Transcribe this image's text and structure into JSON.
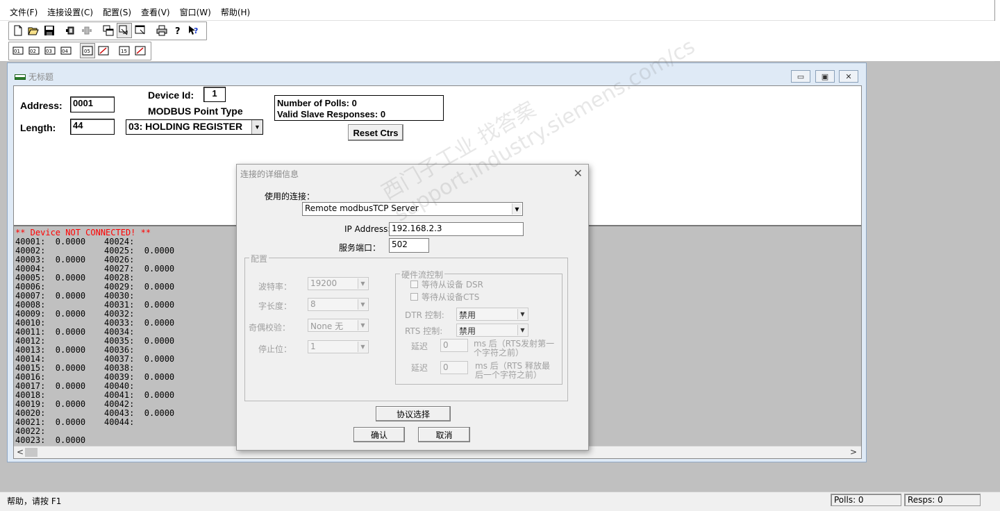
{
  "menu": [
    "文件(F)",
    "连接设置(C)",
    "配置(S)",
    "查看(V)",
    "窗口(W)",
    "帮助(H)"
  ],
  "toolbar1_icons": [
    "new-file-icon",
    "open-folder-icon",
    "save-icon",
    "connect-icon",
    "disconnect-icon",
    "window-tile-icon",
    "window-cascade-icon",
    "window-arrange-icon",
    "print-icon",
    "help-icon",
    "context-help-icon"
  ],
  "toolbar2_icons": [
    "coil-01-icon",
    "input-02-icon",
    "input-03-icon",
    "register-04-icon",
    "function-05-icon",
    "function-06-icon",
    "function-15-icon",
    "function-16-icon"
  ],
  "child_window": {
    "title": "无标题",
    "address_label": "Address:",
    "address_value": "0001",
    "length_label": "Length:",
    "length_value": "44",
    "device_id_label": "Device Id:",
    "device_id_value": "1",
    "point_type_label": "MODBUS Point Type",
    "point_type_value": "03: HOLDING REGISTER",
    "polls_line": "Number of Polls: 0",
    "responses_line": "Valid Slave Responses: 0",
    "reset_button": "Reset Ctrs"
  },
  "data_view": {
    "error": "** Device NOT CONNECTED! **",
    "col1": [
      "40001:  0.0000",
      "40002:",
      "40003:  0.0000",
      "40004:",
      "40005:  0.0000",
      "40006:",
      "40007:  0.0000",
      "40008:",
      "40009:  0.0000",
      "40010:",
      "40011:  0.0000",
      "40012:",
      "40013:  0.0000",
      "40014:",
      "40015:  0.0000",
      "40016:",
      "40017:  0.0000",
      "40018:",
      "40019:  0.0000",
      "40020:",
      "40021:  0.0000",
      "40022:",
      "40023:  0.0000"
    ],
    "col2": [
      "40024:",
      "40025:  0.0000",
      "40026:",
      "40027:  0.0000",
      "40028:",
      "40029:  0.0000",
      "40030:",
      "40031:  0.0000",
      "40032:",
      "40033:  0.0000",
      "40034:",
      "40035:  0.0000",
      "40036:",
      "40037:  0.0000",
      "40038:",
      "40039:  0.0000",
      "40040:",
      "40041:  0.0000",
      "40042:",
      "40043:  0.0000",
      "40044:"
    ]
  },
  "dialog": {
    "title": "连接的详细信息",
    "connection_label": "使用的连接：",
    "connection_value": "Remote modbusTCP Server",
    "ip_label": "IP Address:",
    "ip_value": "192.168.2.3",
    "port_label": "服务端口：",
    "port_value": "502",
    "config_group": "配置",
    "baud_label": "波特率：",
    "baud_value": "19200",
    "wordlen_label": "字长度：",
    "wordlen_value": "8",
    "parity_label": "奇偶校验：",
    "parity_value": "None 无",
    "stopbits_label": "停止位：",
    "stopbits_value": "1",
    "flow_group": "硬件流控制",
    "wait_dsr": "等待从设备 DSR",
    "wait_cts": "等待从设备CTS",
    "dtr_label": "DTR 控制:",
    "dtr_value": "禁用",
    "rts_label": "RTS 控制:",
    "rts_value": "禁用",
    "delay_label_1": "延迟",
    "delay_value_1": "0",
    "delay_note_1": "ms 后（RTS发射第一个字符之前）",
    "delay_label_2": "延迟",
    "delay_value_2": "0",
    "delay_note_2": "ms 后（RTS 释放最后一个字符之前）",
    "protocol_button": "协议选择",
    "ok_button": "确认",
    "cancel_button": "取消",
    "watermark": "西门子工业 找答案 support.industry.siemens.com/cs"
  },
  "status": {
    "help": "帮助，请按 F1",
    "polls": "Polls: 0",
    "resps": "Resps: 0"
  }
}
